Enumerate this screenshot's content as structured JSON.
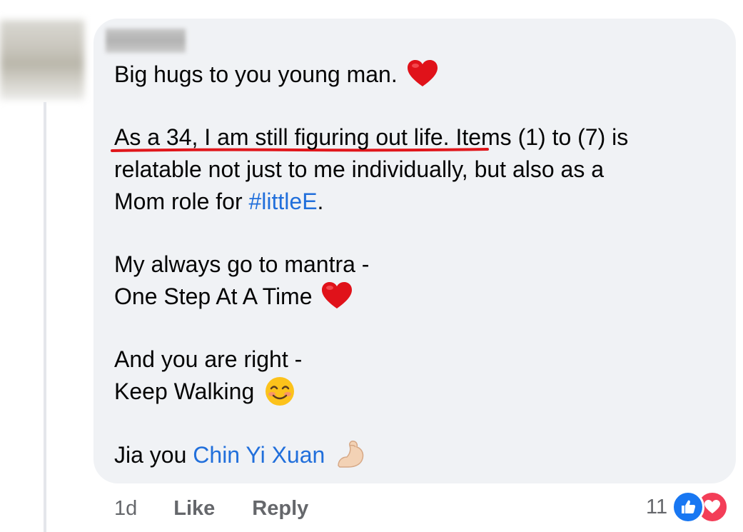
{
  "comment": {
    "paragraphs": {
      "p1": "Big hugs to you young man.",
      "p2_underlined": "As a 34, I am still figuring out life.",
      "p2_rest_line1": " Items (1) to (7) is",
      "p2_line2": "relatable not just to me individually, but also as a",
      "p2_line3_prefix": "Mom role for ",
      "p2_hashtag": "#littleE",
      "p2_line3_suffix": ".",
      "p3_line1": "My always go to mantra -",
      "p3_line2": "One Step At A Time",
      "p4_line1": "And you are right -",
      "p4_line2": "Keep Walking",
      "p5_prefix": "Jia you ",
      "p5_mention": "Chin Yi Xuan"
    },
    "emojis": [
      "red-heart-icon",
      "red-heart-icon",
      "smiling-face-icon",
      "flexed-biceps-icon"
    ],
    "annotation_color": "#e0161b",
    "link_color": "#216fdb"
  },
  "footer": {
    "time": "1d",
    "like_label": "Like",
    "reply_label": "Reply",
    "reaction_count": "11",
    "reaction_icons": [
      "thumbs-up-icon",
      "heart-icon"
    ]
  }
}
